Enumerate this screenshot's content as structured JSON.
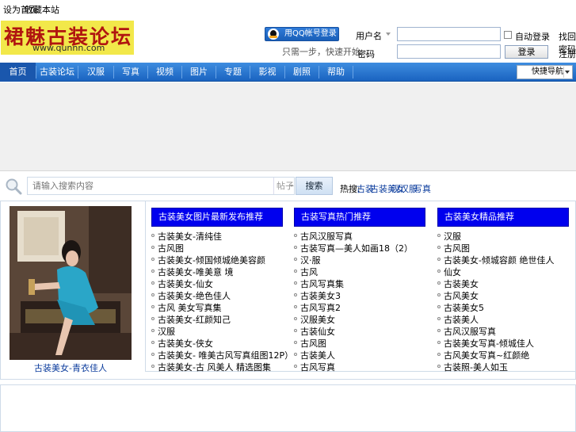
{
  "topbar": {
    "link1": "设为首页",
    "link2": "收藏本站"
  },
  "logo": {
    "brand": "裙魅古装论坛",
    "url": "www.qunnn.com"
  },
  "qq": {
    "login_label": "用QQ帐号登录",
    "subtext": "只需一步，快速开始"
  },
  "login": {
    "user_type": "用户名",
    "password_label": "密码",
    "remember_label": "自动登录",
    "forgot_label": "找回密码",
    "login_button": "登录",
    "register_label": "注册"
  },
  "nav": {
    "items": [
      "首页",
      "古装论坛",
      "汉服",
      "写真",
      "视频",
      "图片",
      "专题",
      "影视",
      "剧照",
      "帮助"
    ],
    "quick_nav": "快捷导航"
  },
  "search": {
    "placeholder": "请输入搜索内容",
    "type": "帖子",
    "button": "搜索",
    "hot_label": "热搜:",
    "hot_terms": [
      "古装",
      "古装美女",
      "汉",
      "汉服",
      "写真"
    ]
  },
  "feature": {
    "caption": "古装美女-青衣佳人"
  },
  "columns": [
    {
      "title": "古装美女图片最新发布推荐",
      "items": [
        "古装美女-清纯佳",
        "古风图",
        "古装美女-倾国倾城绝美容颜",
        "古装美女-唯美意 境",
        "古装美女-仙女",
        "古装美女-绝色佳人",
        "古风 美女写真集",
        "古装美女-红颜知己",
        "汉服",
        "古装美女-侠女",
        "古装美女- 唯美古风写真组图12P）",
        "古装美女-古 风美人 精选图集"
      ]
    },
    {
      "title": "古装写真热门推荐",
      "items": [
        "古风汉服写真",
        "古装写真—美人如画18（2）",
        "汉·服",
        "古风",
        "古风写真集",
        "古装美女3",
        "古风写真2",
        "汉服美女",
        "古装仙女",
        "古风图",
        "古装美人",
        "古风写真"
      ]
    },
    {
      "title": "古装美女精品推荐",
      "items": [
        "汉服",
        "古风图",
        "古装美女-倾城容颜 绝世佳人",
        "仙女",
        "古装美女",
        "古风美女",
        "古装美女5",
        "古装美人",
        "古风汉服写真",
        "古装美女写真-倾城佳人",
        "古风美女写真~红颜绝",
        "古装照-美人如玉"
      ]
    }
  ]
}
